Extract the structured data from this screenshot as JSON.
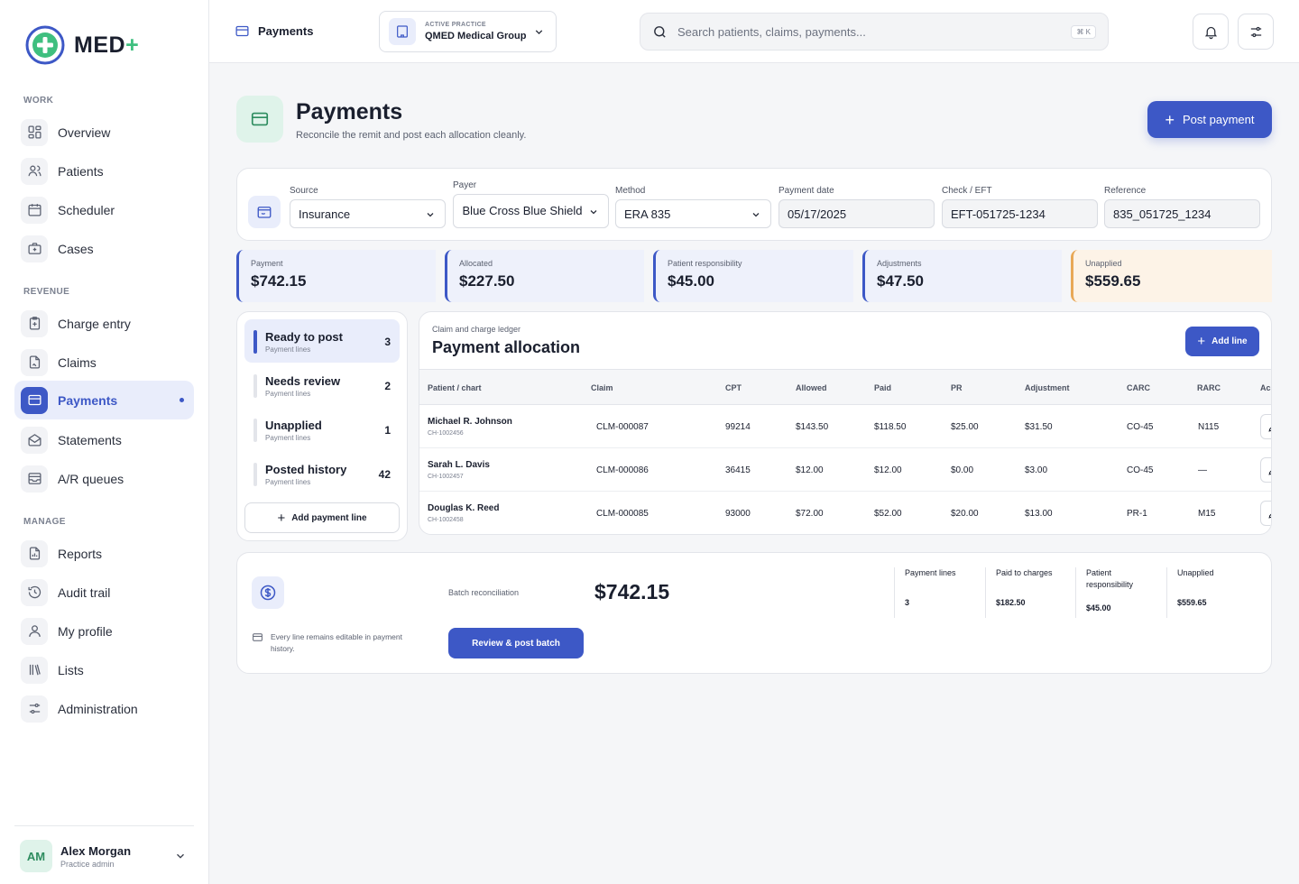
{
  "brand": {
    "name": "MED",
    "plus": "+"
  },
  "sidebar": {
    "sections": [
      {
        "label": "WORK"
      },
      {
        "label": "REVENUE"
      },
      {
        "label": "MANAGE"
      }
    ],
    "items": [
      {
        "label": "Overview",
        "icon": "grid-icon"
      },
      {
        "label": "Patients",
        "icon": "users-icon"
      },
      {
        "label": "Scheduler",
        "icon": "calendar-icon"
      },
      {
        "label": "Cases",
        "icon": "briefcase-icon"
      },
      {
        "label": "Charge entry",
        "icon": "clipboard-plus-icon"
      },
      {
        "label": "Claims",
        "icon": "file-icon"
      },
      {
        "label": "Payments",
        "icon": "credit-card-icon",
        "active": true
      },
      {
        "label": "Statements",
        "icon": "mail-open-icon"
      },
      {
        "label": "A/R queues",
        "icon": "inbox-icon"
      },
      {
        "label": "Reports",
        "icon": "report-icon"
      },
      {
        "label": "Audit trail",
        "icon": "history-icon"
      },
      {
        "label": "My profile",
        "icon": "user-icon"
      },
      {
        "label": "Lists",
        "icon": "library-icon"
      },
      {
        "label": "Administration",
        "icon": "sliders-icon"
      }
    ],
    "user": {
      "initials": "AM",
      "name": "Alex Morgan",
      "role": "Practice admin"
    }
  },
  "topbar": {
    "breadcrumb": "Payments",
    "practice": {
      "caption": "ACTIVE PRACTICE",
      "name": "QMED Medical Group"
    },
    "search": {
      "placeholder": "Search patients, claims, payments...",
      "shortcut": "⌘ K"
    }
  },
  "page": {
    "title": "Payments",
    "subtitle": "Reconcile the remit and post each allocation cleanly.",
    "primary_action": "Post payment"
  },
  "filters": {
    "source": {
      "label": "Source",
      "value": "Insurance"
    },
    "payer": {
      "label": "Payer",
      "value": "Blue Cross Blue Shield"
    },
    "method": {
      "label": "Method",
      "value": "ERA 835"
    },
    "payment_date": {
      "label": "Payment date",
      "value": "05/17/2025"
    },
    "check_eft": {
      "label": "Check / EFT",
      "value": "EFT-051725-1234"
    },
    "reference": {
      "label": "Reference",
      "value": "835_051725_1234"
    }
  },
  "stats": [
    {
      "label": "Payment",
      "value": "$742.15"
    },
    {
      "label": "Allocated",
      "value": "$227.50"
    },
    {
      "label": "Patient responsibility",
      "value": "$45.00"
    },
    {
      "label": "Adjustments",
      "value": "$47.50"
    },
    {
      "label": "Unapplied",
      "value": "$559.65"
    }
  ],
  "queues": [
    {
      "title": "Ready to post",
      "sub": "Payment lines",
      "count": "3"
    },
    {
      "title": "Needs review",
      "sub": "Payment lines",
      "count": "2"
    },
    {
      "title": "Unapplied",
      "sub": "Payment lines",
      "count": "1"
    },
    {
      "title": "Posted history",
      "sub": "Payment lines",
      "count": "42"
    }
  ],
  "add_payment_line": "Add payment line",
  "allocation": {
    "caption": "Claim and charge ledger",
    "title": "Payment allocation",
    "add_line": "Add line",
    "columns": [
      "Patient / chart",
      "Claim",
      "CPT",
      "Allowed",
      "Paid",
      "PR",
      "Adjustment",
      "CARC",
      "RARC",
      "Ac"
    ],
    "rows": [
      {
        "name": "Michael R. Johnson",
        "chart": "CH-1002456",
        "claim": "CLM-000087",
        "cpt": "99214",
        "allowed": "$143.50",
        "paid": "$118.50",
        "pr": "$25.00",
        "adjustment": "$31.50",
        "carc": "CO-45",
        "rarc": "N115"
      },
      {
        "name": "Sarah L. Davis",
        "chart": "CH-1002457",
        "claim": "CLM-000086",
        "cpt": "36415",
        "allowed": "$12.00",
        "paid": "$12.00",
        "pr": "$0.00",
        "adjustment": "$3.00",
        "carc": "CO-45",
        "rarc": "—"
      },
      {
        "name": "Douglas K. Reed",
        "chart": "CH-1002458",
        "claim": "CLM-000085",
        "cpt": "93000",
        "allowed": "$72.00",
        "paid": "$52.00",
        "pr": "$20.00",
        "adjustment": "$13.00",
        "carc": "PR-1",
        "rarc": "M15"
      }
    ]
  },
  "batch": {
    "label": "Batch reconciliation",
    "total": "$742.15",
    "note": "Every line remains editable in payment history.",
    "action": "Review & post batch",
    "summary": [
      {
        "label": "Payment lines",
        "value": "3"
      },
      {
        "label": "Paid to charges",
        "value": "$182.50"
      },
      {
        "label": "Patient responsibility",
        "value": "$45.00"
      },
      {
        "label": "Unapplied",
        "value": "$559.65"
      }
    ]
  },
  "colors": {
    "accent": "#3d58c6",
    "brand_green": "#3fbf7f",
    "warning": "#e8a857"
  }
}
